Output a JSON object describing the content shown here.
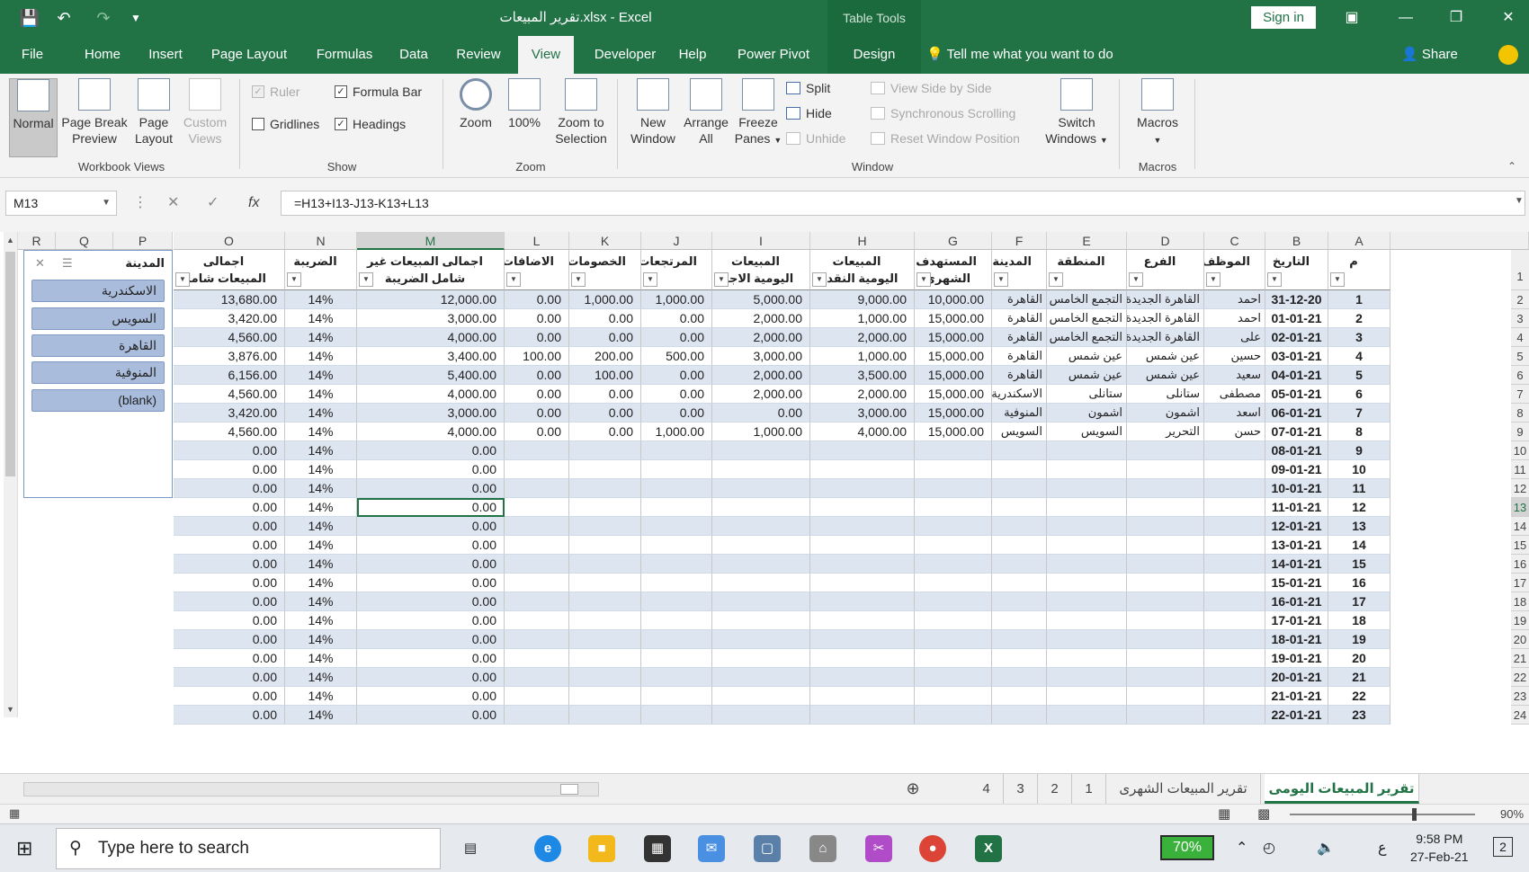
{
  "titlebar": {
    "title": "تقرير المبيعات.xlsx  -  Excel",
    "table_tools": "Table Tools",
    "sign_in": "Sign in"
  },
  "tabs": [
    "File",
    "Home",
    "Insert",
    "Page Layout",
    "Formulas",
    "Data",
    "Review",
    "View",
    "Developer",
    "Help",
    "Power Pivot",
    "Design"
  ],
  "active_tab": "View",
  "tell_me": "Tell me what you want to do",
  "share": "Share",
  "ribbon": {
    "workbook_views": {
      "label": "Workbook Views",
      "normal": "Normal",
      "page_break_1": "Page Break",
      "page_break_2": "Preview",
      "page_layout_1": "Page",
      "page_layout_2": "Layout",
      "custom_1": "Custom",
      "custom_2": "Views"
    },
    "show": {
      "label": "Show",
      "ruler": "Ruler",
      "formula_bar": "Formula Bar",
      "gridlines": "Gridlines",
      "headings": "Headings"
    },
    "zoom": {
      "label": "Zoom",
      "zoom": "Zoom",
      "p100": "100%",
      "zts_1": "Zoom to",
      "zts_2": "Selection"
    },
    "window": {
      "label": "Window",
      "new_1": "New",
      "new_2": "Window",
      "arrange_1": "Arrange",
      "arrange_2": "All",
      "freeze_1": "Freeze",
      "freeze_2": "Panes",
      "split": "Split",
      "hide": "Hide",
      "unhide": "Unhide",
      "side_by_side": "View Side by Side",
      "sync_scroll": "Synchronous Scrolling",
      "reset_pos": "Reset Window Position",
      "switch_1": "Switch",
      "switch_2": "Windows"
    },
    "macros": {
      "label": "Macros",
      "macros": "Macros"
    }
  },
  "formula_bar": {
    "name_box": "M13",
    "formula": "=H13+I13-J13-K13+L13"
  },
  "columns": [
    "R",
    "Q",
    "P",
    "O",
    "N",
    "M",
    "L",
    "K",
    "J",
    "I",
    "H",
    "G",
    "F",
    "E",
    "D",
    "C",
    "B",
    "A"
  ],
  "selected_column": "M",
  "headers": {
    "O": "اجمالى المبيعات شامل الضريبة",
    "N": "الضريبة",
    "M": "اجمالى المبيعات غير شامل الضريبة",
    "L": "الاضافات",
    "K": "الخصومات",
    "J": "المرتجعات",
    "I": "المبيعات اليومية الاجلة",
    "H": "المبيعات اليومية النقدية",
    "G": "المستهدف الشهرى",
    "F": "المدينة",
    "E": "المنطقة",
    "D": "الفرع",
    "C": "الموظف",
    "B": "التاريخ",
    "A": "م"
  },
  "rows": [
    {
      "O": "13,680.00",
      "N": "14%",
      "M": "12,000.00",
      "L": "0.00",
      "K": "1,000.00",
      "J": "1,000.00",
      "I": "5,000.00",
      "H": "9,000.00",
      "G": "10,000.00",
      "F": "القاهرة",
      "E": "التجمع الخامس",
      "D": "القاهرة الجديدة",
      "C": "احمد",
      "B": "31-12-20",
      "A": "1"
    },
    {
      "O": "3,420.00",
      "N": "14%",
      "M": "3,000.00",
      "L": "0.00",
      "K": "0.00",
      "J": "0.00",
      "I": "2,000.00",
      "H": "1,000.00",
      "G": "15,000.00",
      "F": "القاهرة",
      "E": "التجمع الخامس",
      "D": "القاهرة الجديدة",
      "C": "احمد",
      "B": "01-01-21",
      "A": "2"
    },
    {
      "O": "4,560.00",
      "N": "14%",
      "M": "4,000.00",
      "L": "0.00",
      "K": "0.00",
      "J": "0.00",
      "I": "2,000.00",
      "H": "2,000.00",
      "G": "15,000.00",
      "F": "القاهرة",
      "E": "التجمع الخامس",
      "D": "القاهرة الجديدة",
      "C": "على",
      "B": "02-01-21",
      "A": "3"
    },
    {
      "O": "3,876.00",
      "N": "14%",
      "M": "3,400.00",
      "L": "100.00",
      "K": "200.00",
      "J": "500.00",
      "I": "3,000.00",
      "H": "1,000.00",
      "G": "15,000.00",
      "F": "القاهرة",
      "E": "عين شمس",
      "D": "عين شمس",
      "C": "حسين",
      "B": "03-01-21",
      "A": "4"
    },
    {
      "O": "6,156.00",
      "N": "14%",
      "M": "5,400.00",
      "L": "0.00",
      "K": "100.00",
      "J": "0.00",
      "I": "2,000.00",
      "H": "3,500.00",
      "G": "15,000.00",
      "F": "القاهرة",
      "E": "عين شمس",
      "D": "عين شمس",
      "C": "سعيد",
      "B": "04-01-21",
      "A": "5"
    },
    {
      "O": "4,560.00",
      "N": "14%",
      "M": "4,000.00",
      "L": "0.00",
      "K": "0.00",
      "J": "0.00",
      "I": "2,000.00",
      "H": "2,000.00",
      "G": "15,000.00",
      "F": "الاسكندرية",
      "E": "ستانلى",
      "D": "ستانلى",
      "C": "مصطفى",
      "B": "05-01-21",
      "A": "6"
    },
    {
      "O": "3,420.00",
      "N": "14%",
      "M": "3,000.00",
      "L": "0.00",
      "K": "0.00",
      "J": "0.00",
      "I": "0.00",
      "H": "3,000.00",
      "G": "15,000.00",
      "F": "المنوفية",
      "E": "اشمون",
      "D": "اشمون",
      "C": "اسعد",
      "B": "06-01-21",
      "A": "7"
    },
    {
      "O": "4,560.00",
      "N": "14%",
      "M": "4,000.00",
      "L": "0.00",
      "K": "0.00",
      "J": "1,000.00",
      "I": "1,000.00",
      "H": "4,000.00",
      "G": "15,000.00",
      "F": "السويس",
      "E": "السويس",
      "D": "التحرير",
      "C": "حسن",
      "B": "07-01-21",
      "A": "8"
    },
    {
      "O": "0.00",
      "N": "14%",
      "M": "0.00",
      "B": "08-01-21",
      "A": "9"
    },
    {
      "O": "0.00",
      "N": "14%",
      "M": "0.00",
      "B": "09-01-21",
      "A": "10"
    },
    {
      "O": "0.00",
      "N": "14%",
      "M": "0.00",
      "B": "10-01-21",
      "A": "11"
    },
    {
      "O": "0.00",
      "N": "14%",
      "M": "0.00",
      "B": "11-01-21",
      "A": "12"
    },
    {
      "O": "0.00",
      "N": "14%",
      "M": "0.00",
      "B": "12-01-21",
      "A": "13"
    },
    {
      "O": "0.00",
      "N": "14%",
      "M": "0.00",
      "B": "13-01-21",
      "A": "14"
    },
    {
      "O": "0.00",
      "N": "14%",
      "M": "0.00",
      "B": "14-01-21",
      "A": "15"
    },
    {
      "O": "0.00",
      "N": "14%",
      "M": "0.00",
      "B": "15-01-21",
      "A": "16"
    },
    {
      "O": "0.00",
      "N": "14%",
      "M": "0.00",
      "B": "16-01-21",
      "A": "17"
    },
    {
      "O": "0.00",
      "N": "14%",
      "M": "0.00",
      "B": "17-01-21",
      "A": "18"
    },
    {
      "O": "0.00",
      "N": "14%",
      "M": "0.00",
      "B": "18-01-21",
      "A": "19"
    },
    {
      "O": "0.00",
      "N": "14%",
      "M": "0.00",
      "B": "19-01-21",
      "A": "20"
    },
    {
      "O": "0.00",
      "N": "14%",
      "M": "0.00",
      "B": "20-01-21",
      "A": "21"
    },
    {
      "O": "0.00",
      "N": "14%",
      "M": "0.00",
      "B": "21-01-21",
      "A": "22"
    },
    {
      "O": "0.00",
      "N": "14%",
      "M": "0.00",
      "B": "22-01-21",
      "A": "23"
    }
  ],
  "row_numbers": [
    "1",
    "2",
    "3",
    "4",
    "5",
    "6",
    "7",
    "8",
    "9",
    "10",
    "11",
    "12",
    "13",
    "14",
    "15",
    "16",
    "17",
    "18",
    "19",
    "20",
    "21",
    "22",
    "23",
    "24"
  ],
  "selected_row": "13",
  "slicer": {
    "title": "المدينة",
    "items": [
      "الاسكندرية",
      "السويس",
      "القاهرة",
      "المنوفية",
      "(blank)"
    ]
  },
  "sheet_tabs": [
    "4",
    "3",
    "2",
    "1",
    "تقرير المبيعات الشهرى",
    "تقرير المبيعات اليومى"
  ],
  "active_sheet": "تقرير المبيعات اليومى",
  "status": {
    "zoom": "90%"
  },
  "taskbar": {
    "search_placeholder": "Type here to search",
    "battery": "70%",
    "lang": "ع",
    "time": "9:58 PM",
    "date": "27-Feb-21",
    "notifications": "2"
  },
  "colors": {
    "excel_green": "#217346",
    "band": "#dde5f1",
    "slicer_item": "#a9bcdc"
  }
}
